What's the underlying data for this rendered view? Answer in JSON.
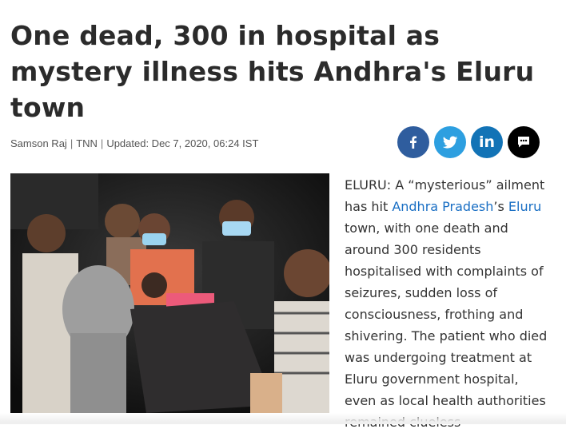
{
  "article": {
    "headline": "One dead, 300 in hospital as mystery illness hits Andhra's Eluru town",
    "byline": {
      "author": "Samson Raj",
      "source": "TNN",
      "updated": "Updated: Dec 7, 2020, 06:24 IST"
    },
    "body": {
      "lead": "ELURU: A “mysterious” ailment has hit ",
      "link1": "Andhra Pradesh",
      "mid": "’s ",
      "link2": "Eluru",
      "rest": " town, with one death and around 300 residents hospitalised with complaints of seizures, sudden loss of consciousness, frothing and shivering. The patient who died was undergoing treatment at Eluru government hospital, even as local health authorities remained clueless"
    }
  },
  "share": {
    "buttons": [
      {
        "icon": "facebook-icon",
        "color": "#2f5d9e"
      },
      {
        "icon": "twitter-icon",
        "color": "#2d9fe0"
      },
      {
        "icon": "linkedin-icon",
        "label": "in",
        "color": "#1273b6"
      },
      {
        "icon": "comment-icon",
        "color": "#000000"
      }
    ]
  },
  "colors": {
    "link": "#1a6fc4",
    "headline": "#2b2b2b"
  }
}
